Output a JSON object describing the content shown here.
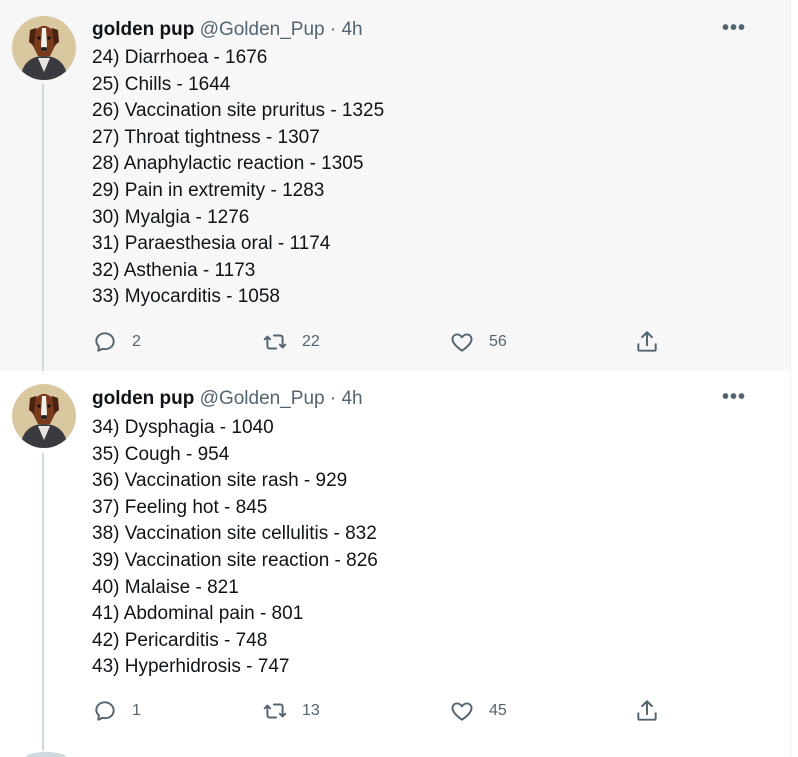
{
  "tweets": [
    {
      "display_name": "golden pup",
      "handle": "@Golden_Pup",
      "separator": "·",
      "time": "4h",
      "more": "•••",
      "lines": [
        "24) Diarrhoea - 1676",
        "25) Chills - 1644",
        "26) Vaccination site pruritus - 1325",
        "27) Throat tightness - 1307",
        "28) Anaphylactic reaction - 1305",
        "29) Pain in extremity - 1283",
        "30) Myalgia - 1276",
        "31) Paraesthesia oral - 1174",
        "32) Asthenia - 1173",
        "33) Myocarditis - 1058"
      ],
      "replies": "2",
      "retweets": "22",
      "likes": "56"
    },
    {
      "display_name": "golden pup",
      "handle": "@Golden_Pup",
      "separator": "·",
      "time": "4h",
      "more": "•••",
      "lines": [
        "34) Dysphagia - 1040",
        "35) Cough - 954",
        "36) Vaccination site rash - 929",
        "37) Feeling hot - 845",
        "38) Vaccination site cellulitis - 832",
        "39) Vaccination site reaction - 826",
        "40) Malaise - 821",
        "41) Abdominal pain - 801",
        "42) Pericarditis - 748",
        "43) Hyperhidrosis - 747"
      ],
      "replies": "1",
      "retweets": "13",
      "likes": "45"
    }
  ],
  "icons": {
    "reply": "reply-icon",
    "retweet": "retweet-icon",
    "like": "heart-icon",
    "share": "share-icon",
    "more": "more-icon",
    "avatar": "dog-portrait-avatar"
  },
  "colors": {
    "text": "#0f1419",
    "secondary": "#536471",
    "thread_line": "#cfd9de",
    "highlight_bg": "#f7f7f7"
  }
}
